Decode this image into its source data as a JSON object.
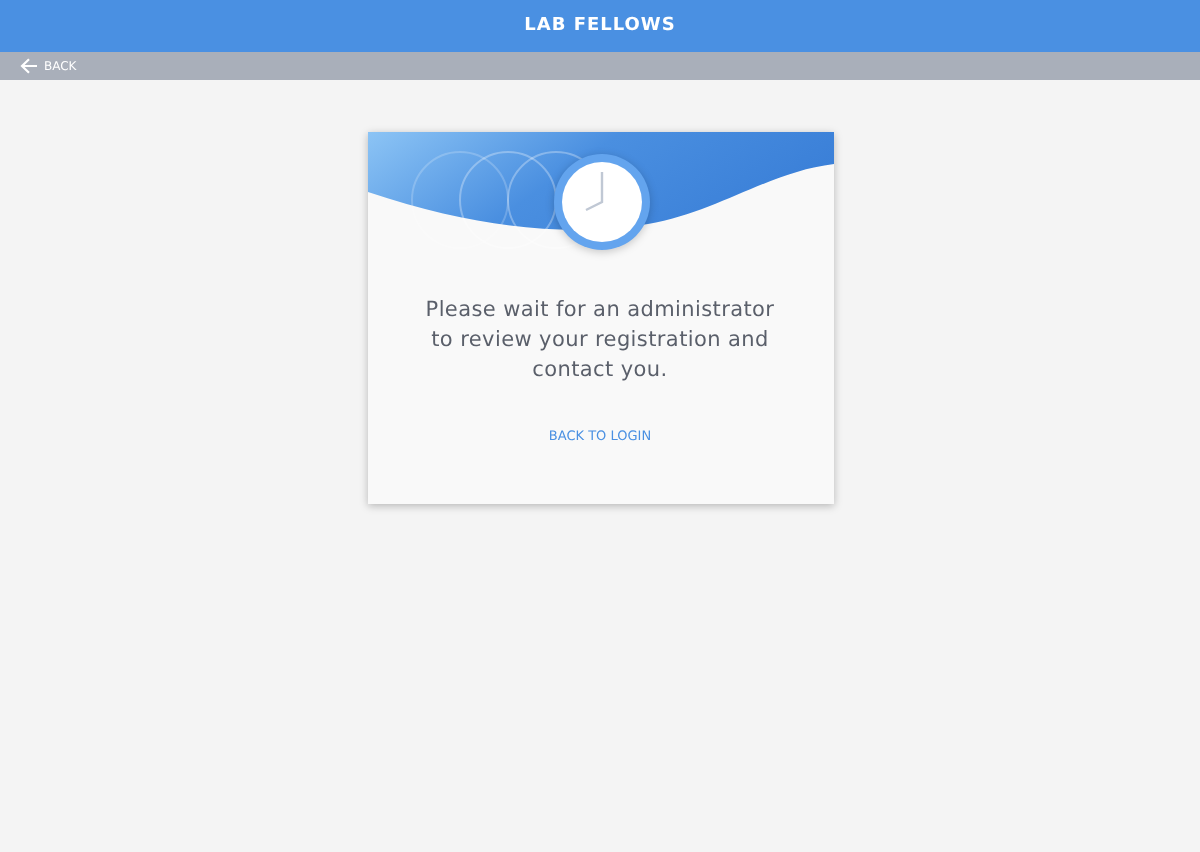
{
  "app_bar": {
    "title": "LAB FELLOWS"
  },
  "nav_bar": {
    "back_label": "BACK"
  },
  "card": {
    "message": "Please wait for an administrator to review your registration and contact you.",
    "link": "BACK TO LOGIN"
  }
}
